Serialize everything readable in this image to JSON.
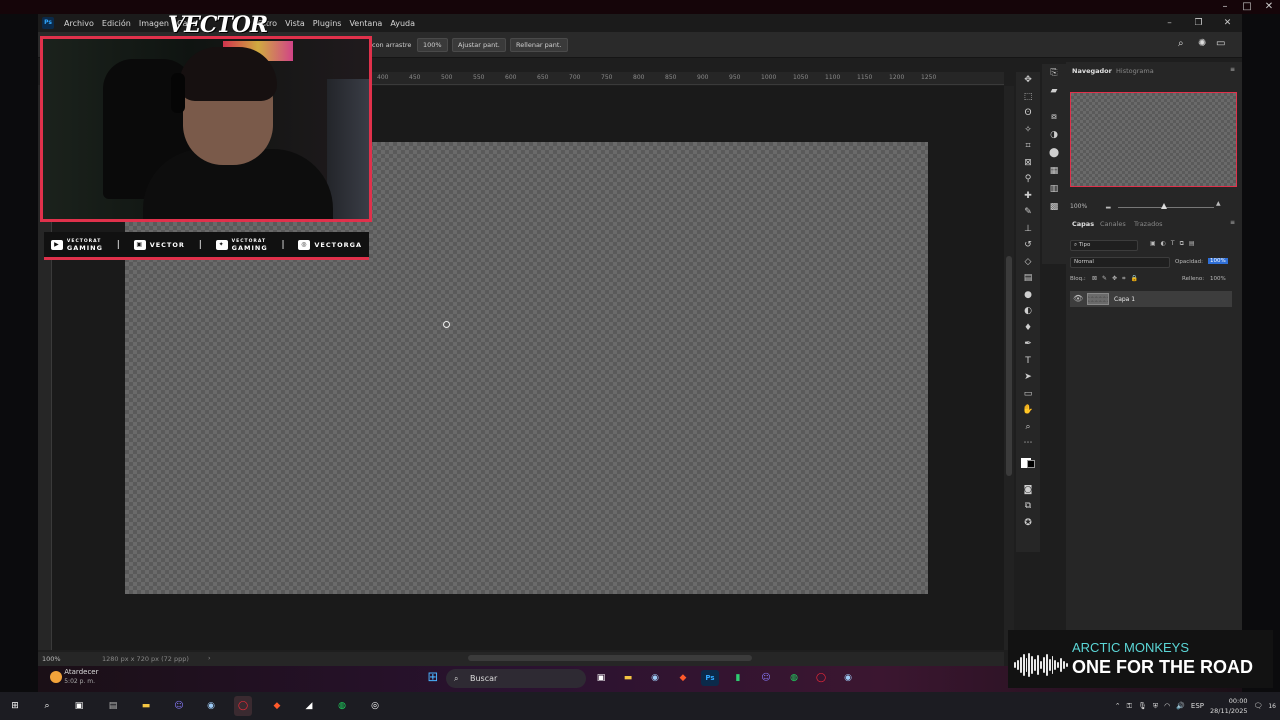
{
  "colors": {
    "accent": "#e0314b",
    "ps_blue": "#31a8ff",
    "now_playing_artist": "#5bd6d6"
  },
  "menubar": {
    "app_icon": "Ps",
    "items": [
      "Archivo",
      "Edición",
      "Imagen",
      "Capa",
      "Filtro",
      "Vista",
      "Plugins",
      "Ventana",
      "Ayuda"
    ]
  },
  "options_bar": {
    "scroll_label": "con arrastre",
    "zoom_btn": "100%",
    "fit_btn": "Ajustar pant.",
    "fill_btn": "Rellenar pant."
  },
  "ruler": {
    "ticks": [
      "400",
      "450",
      "500",
      "550",
      "600",
      "650",
      "700",
      "750",
      "800",
      "850",
      "900",
      "950",
      "1000",
      "1050",
      "1100",
      "1150",
      "1200",
      "1250"
    ]
  },
  "status_bar": {
    "zoom": "100%",
    "doc_info": "1280 px x 720 px (72 ppp)"
  },
  "navigator": {
    "tabs": [
      "Navegador",
      "Histograma"
    ],
    "zoom": "100%"
  },
  "layers": {
    "tabs": [
      "Capas",
      "Canales",
      "Trazados"
    ],
    "filter_label": "Tipo",
    "blend_mode": "Normal",
    "opacity_label": "Opacidad:",
    "opacity_value": "100%",
    "lock_label": "Bloq.:",
    "fill_label": "Relleno:",
    "fill_value": "100%",
    "layer_names": [
      "Capa 1"
    ]
  },
  "overlay": {
    "brand": "VECTOR",
    "socials": [
      {
        "icon": "youtube-icon",
        "glyph": "▶",
        "line1": "VECTORAT",
        "line2": "GAMING"
      },
      {
        "icon": "twitch-icon",
        "glyph": "▣",
        "line1": "VECTOR",
        "line2": ""
      },
      {
        "icon": "twitter-icon",
        "glyph": "✦",
        "line1": "VECTORAT",
        "line2": "GAMING"
      },
      {
        "icon": "instagram-icon",
        "glyph": "◎",
        "line1": "VECTORGA",
        "line2": ""
      }
    ],
    "separator": "|"
  },
  "now_playing": {
    "artist": "ARCTIC MONKEYS",
    "title": "ONE FOR THE ROAD"
  },
  "taskbar": {
    "weather_title": "Atardecer",
    "weather_time": "5:02 p. m.",
    "search_placeholder": "Buscar",
    "language": "ESP",
    "clock_time": "00:00",
    "clock_date": "28/11/2025",
    "notif_count": "16"
  }
}
